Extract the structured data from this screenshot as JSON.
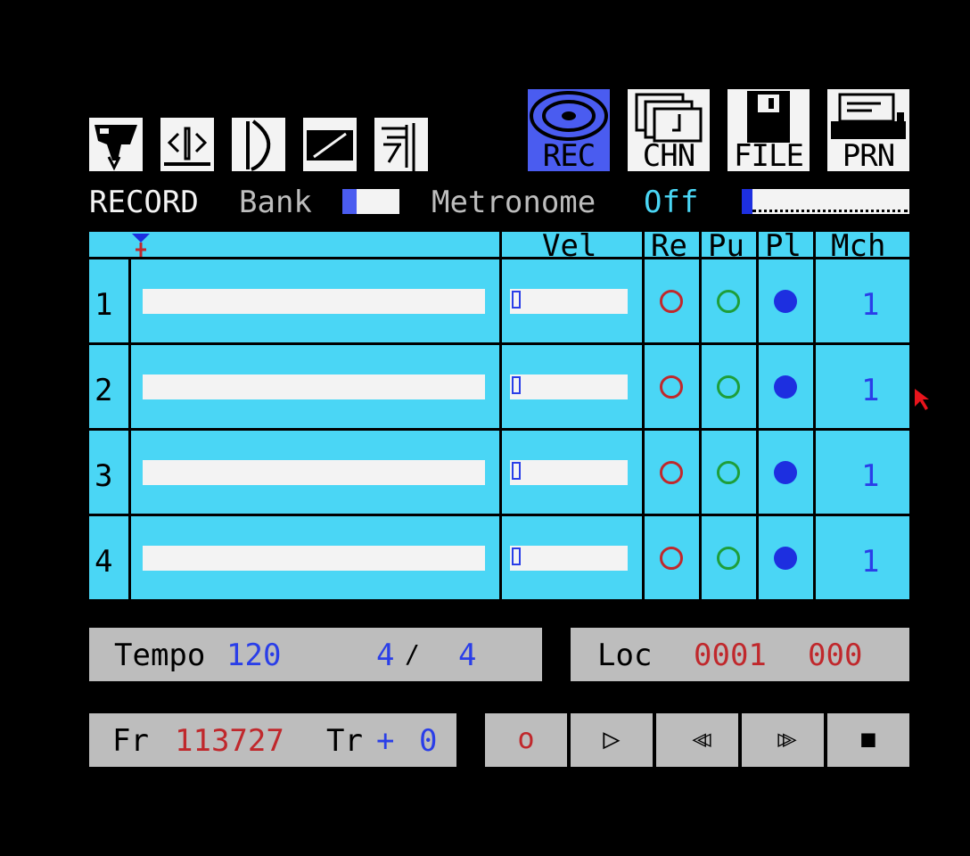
{
  "toolbar": {
    "small_icons": [
      "hand-pointer-icon",
      "split-arrows-icon",
      "bracket-curve-icon",
      "slash-box-icon",
      "tempo-graph-icon"
    ],
    "big_buttons": [
      {
        "label": "REC",
        "icon": "tape-reel-icon",
        "active": true
      },
      {
        "label": "CHN",
        "icon": "stacked-pages-icon",
        "active": false
      },
      {
        "label": "FILE",
        "icon": "floppy-disk-icon",
        "active": false
      },
      {
        "label": "PRN",
        "icon": "printer-icon",
        "active": false
      }
    ]
  },
  "status": {
    "mode": "RECORD",
    "bank_label": "Bank",
    "metronome_label": "Metronome",
    "metronome_value": "Off"
  },
  "grid": {
    "headers": {
      "vel": "Vel",
      "re": "Re",
      "pu": "Pu",
      "pl": "Pl",
      "mch": "Mch"
    },
    "tracks": [
      {
        "number": "1",
        "mch": "1"
      },
      {
        "number": "2",
        "mch": "1"
      },
      {
        "number": "3",
        "mch": "1"
      },
      {
        "number": "4",
        "mch": "1"
      }
    ]
  },
  "tempo": {
    "label": "Tempo",
    "value": "120",
    "beats": "4",
    "sep": "/",
    "unit": "4"
  },
  "locator": {
    "label": "Loc",
    "bar": "0001",
    "tick": "000"
  },
  "memory": {
    "free_label": "Fr",
    "free_value": "113727",
    "transpose_label": "Tr",
    "transpose_sign": "+",
    "transpose_value": "0"
  },
  "transport": [
    {
      "name": "record",
      "glyph": "o"
    },
    {
      "name": "play",
      "glyph": "▷"
    },
    {
      "name": "rewind",
      "glyph": "◁◁"
    },
    {
      "name": "fast-forward",
      "glyph": "▷▷"
    },
    {
      "name": "stop",
      "glyph": "■"
    }
  ],
  "colors": {
    "grid_bg": "#4ad6f5",
    "blue_text": "#2a3ee8",
    "red_text": "#c0282c",
    "green_ring": "#1e9e3a",
    "active_button": "#4a5cf0"
  }
}
